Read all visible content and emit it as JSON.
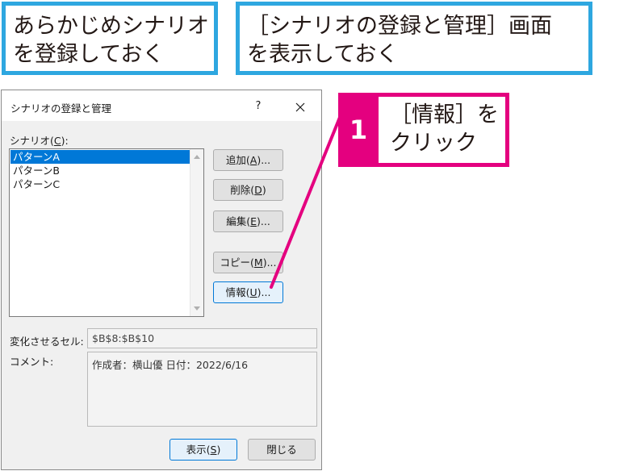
{
  "callouts": {
    "prepare": "あらかじめシナリオ\nを登録しておく",
    "manager": "［シナリオの登録と管理］画面\nを表示しておく",
    "step_number": "1",
    "step_text": "［情報］を\nクリック"
  },
  "dialog": {
    "title": "シナリオの登録と管理",
    "help": "?",
    "scenario_label_prefix": "シナリオ(",
    "scenario_label_key": "C",
    "scenario_label_suffix": "):",
    "scenarios": [
      "パターンA",
      "パターンB",
      "パターンC"
    ],
    "selected_index": 0,
    "buttons": {
      "add": {
        "prefix": "追加(",
        "key": "A",
        "suffix": ")..."
      },
      "delete": {
        "prefix": "削除(",
        "key": "D",
        "suffix": ")"
      },
      "edit": {
        "prefix": "編集(",
        "key": "E",
        "suffix": ")..."
      },
      "copy": {
        "prefix": "コピー(",
        "key": "M",
        "suffix": ")..."
      },
      "info": {
        "prefix": "情報(",
        "key": "U",
        "suffix": ")..."
      },
      "show": {
        "prefix": "表示(",
        "key": "S",
        "suffix": ")"
      },
      "close": {
        "label": "閉じる"
      }
    },
    "changing_cells_label": "変化させるセル:",
    "changing_cells_value": "$B$8:$B$10",
    "comment_label": "コメント:",
    "comment_value": "作成者：横山優 日付：2022/6/16"
  },
  "colors": {
    "callout_border": "#2ea7e0",
    "step_accent": "#e4007f",
    "selection": "#0078d7"
  },
  "icons": {
    "close": "close-icon",
    "scroll_up": "scroll-up-arrow-icon",
    "scroll_down": "scroll-down-arrow-icon"
  }
}
